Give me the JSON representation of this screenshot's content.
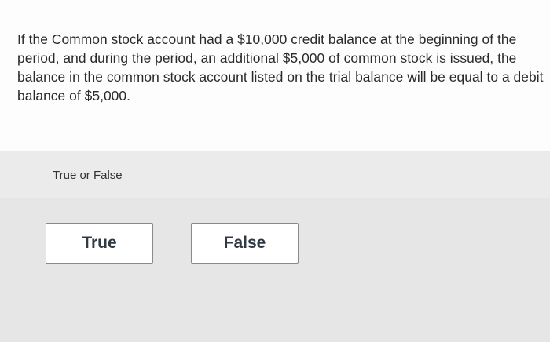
{
  "question": {
    "text": "If the Common stock account had a $10,000 credit balance at the beginning of the period, and during the period, an additional $5,000 of common stock is issued, the balance in the common stock account listed on the trial balance will be equal to a debit balance of $5,000."
  },
  "answer": {
    "prompt": "True or False",
    "options": [
      {
        "label": "True"
      },
      {
        "label": "False"
      }
    ]
  }
}
